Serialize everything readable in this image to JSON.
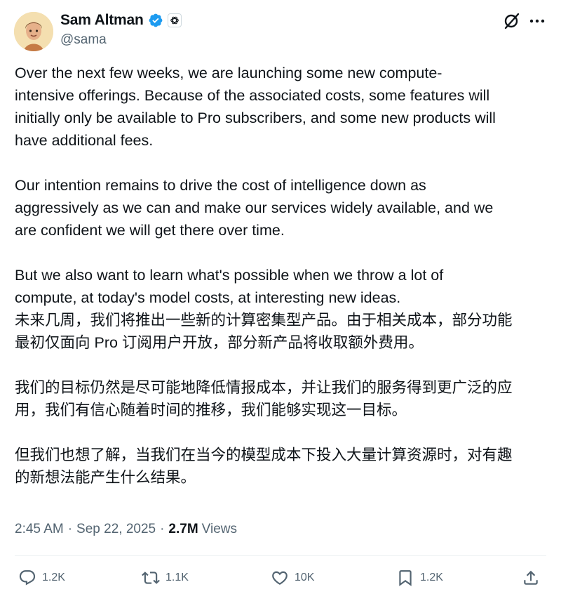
{
  "author": {
    "display_name": "Sam Altman",
    "handle": "@sama",
    "verified": true,
    "affiliate_badge_icon": "openai-logo-icon"
  },
  "header_actions": {
    "grok_icon": "grok-icon",
    "more_icon": "more-dots-icon"
  },
  "tweet": {
    "paragraphs_en": [
      "Over the next few weeks, we are launching some new compute-\nintensive offerings. Because of the associated costs, some features will\ninitially only be available to Pro subscribers, and some new products will\nhave additional fees.",
      "Our intention remains to drive the cost of intelligence down as\naggressively as we can and make our services widely available, and we\nare confident we will get there over time.",
      "But we also want to learn what's possible when we throw a lot of\ncompute, at today's model costs, at interesting new ideas."
    ],
    "paragraphs_zh": [
      "未来几周，我们将推出一些新的计算密集型产品。由于相关成本，部分功能\n最初仅面向 Pro 订阅用户开放，部分新产品将收取额外费用。",
      "我们的目标仍然是尽可能地降低情报成本，并让我们的服务得到更广泛的应\n用，我们有信心随着时间的推移，我们能够实现这一目标。",
      "但我们也想了解，当我们在当今的模型成本下投入大量计算资源时，对有趣\n的新想法能产生什么结果。"
    ]
  },
  "meta": {
    "time": "2:45 AM",
    "separator": "·",
    "date": "Sep 22, 2025",
    "views_count": "2.7M",
    "views_label": "Views"
  },
  "actions": {
    "reply": {
      "icon": "reply-icon",
      "count": "1.2K"
    },
    "repost": {
      "icon": "repost-icon",
      "count": "1.1K"
    },
    "like": {
      "icon": "heart-icon",
      "count": "10K"
    },
    "bookmark": {
      "icon": "bookmark-icon",
      "count": "1.2K"
    },
    "share": {
      "icon": "share-icon"
    }
  },
  "colors": {
    "text_primary": "#0f1419",
    "text_secondary": "#536471",
    "verified_blue": "#1d9bf0",
    "divider": "#eff3f4"
  }
}
